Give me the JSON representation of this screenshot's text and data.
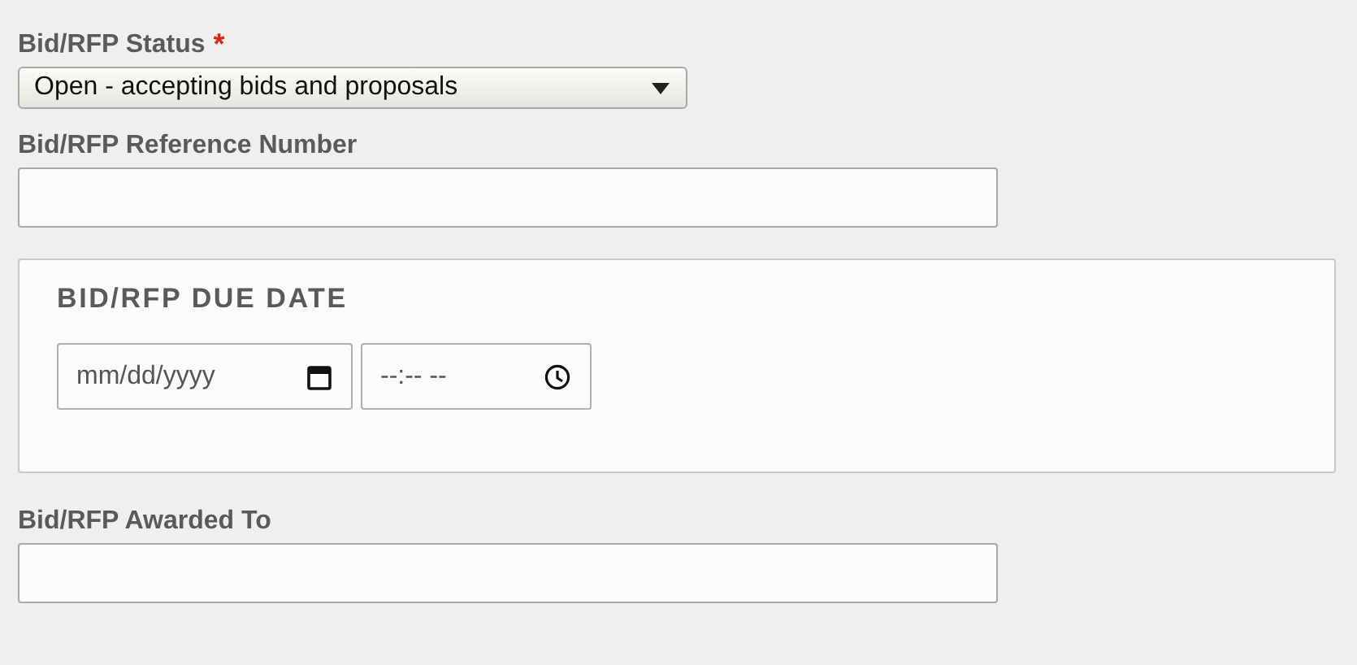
{
  "status_field": {
    "label": "Bid/RFP Status",
    "required_mark": "*",
    "value": "Open - accepting bids and proposals"
  },
  "reference_field": {
    "label": "Bid/RFP Reference Number"
  },
  "due_date": {
    "legend": "BID/RFP DUE DATE",
    "date_placeholder": "mm/dd/yyyy",
    "time_placeholder": "--:-- --"
  },
  "awarded_field": {
    "label": "Bid/RFP Awarded To"
  }
}
